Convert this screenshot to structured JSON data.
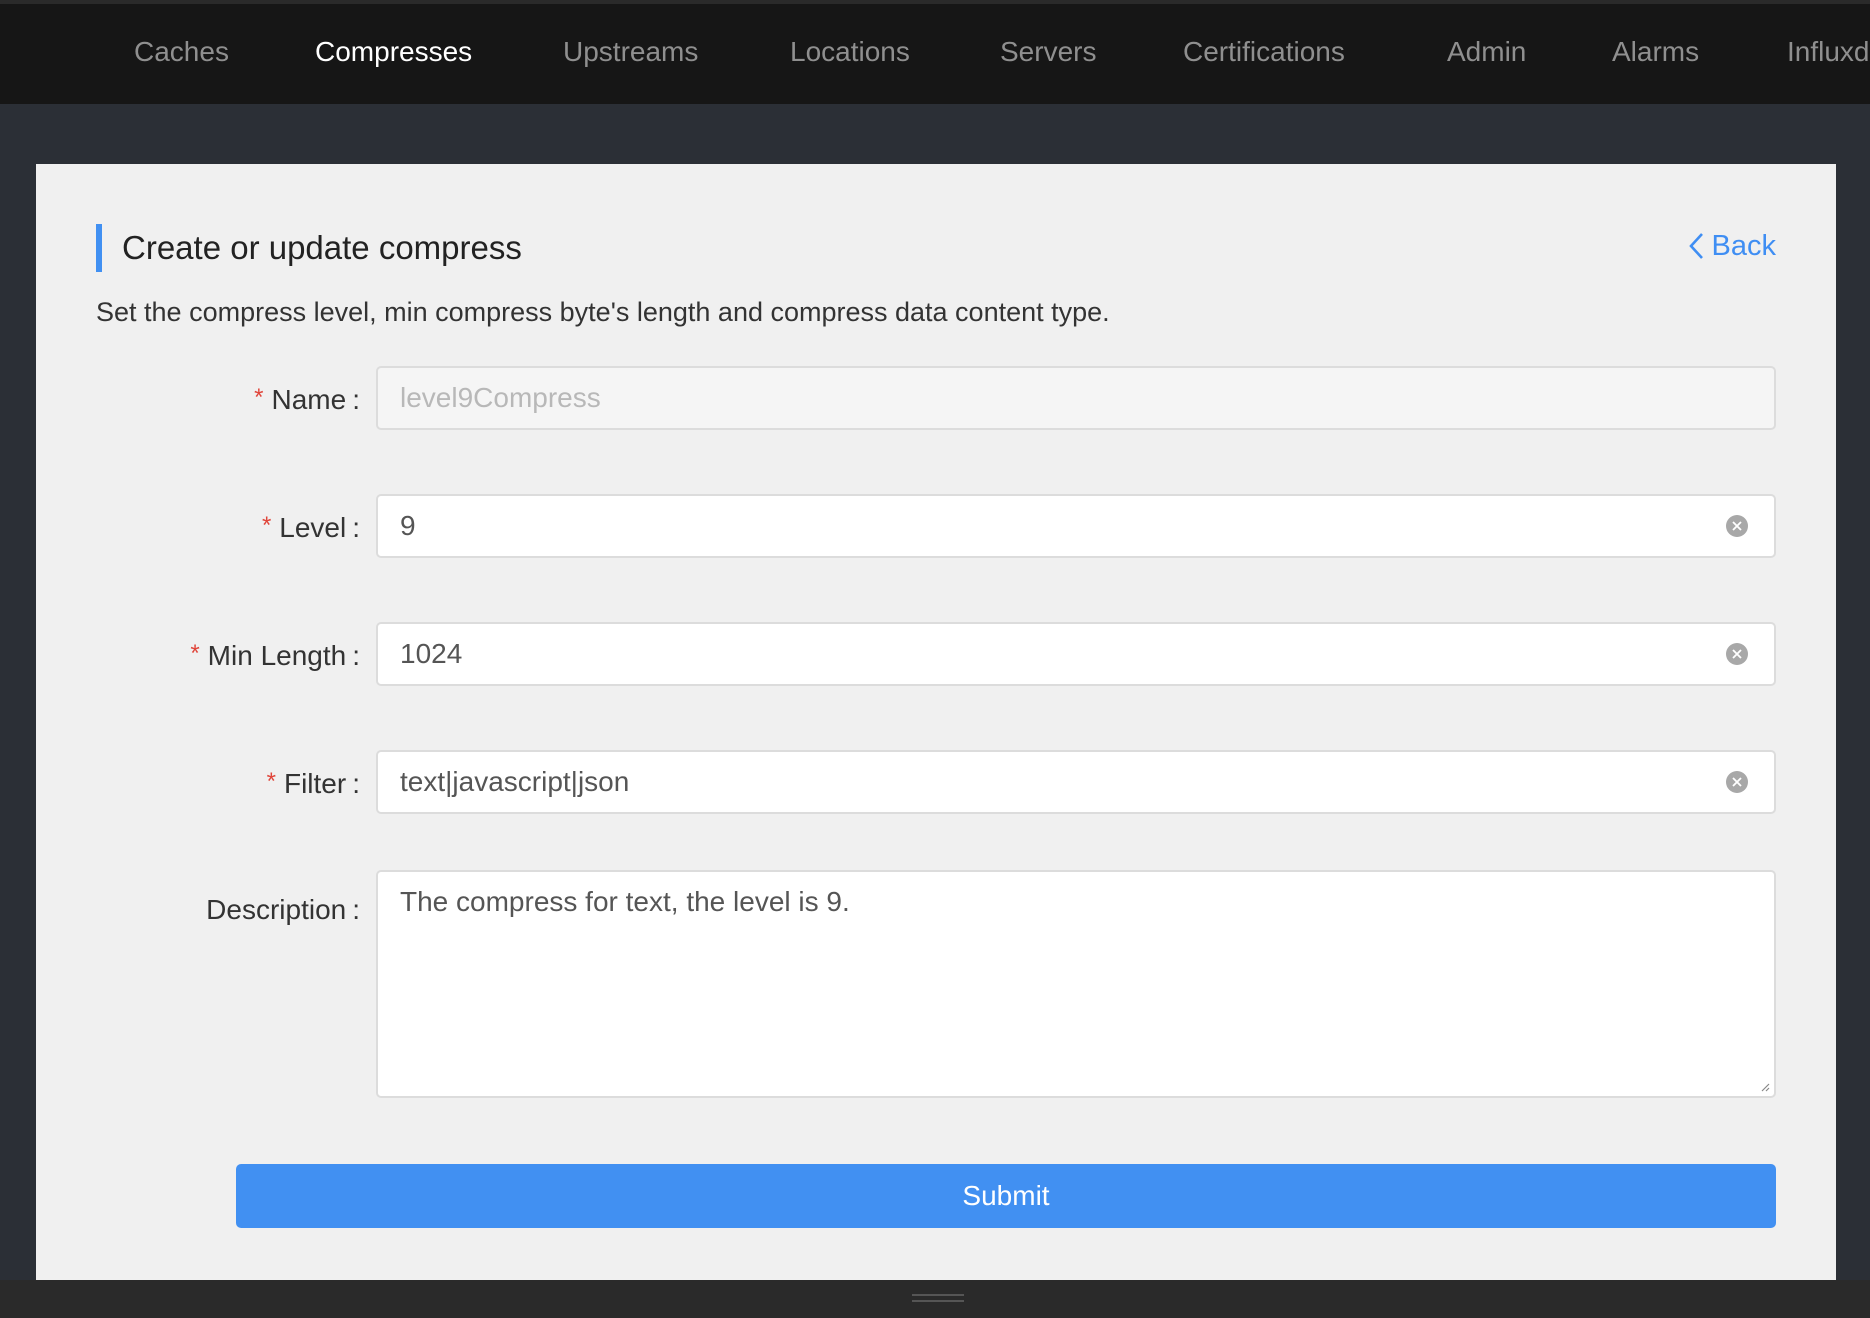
{
  "nav": {
    "items": [
      {
        "label": "Caches",
        "active": false
      },
      {
        "label": "Compresses",
        "active": true
      },
      {
        "label": "Upstreams",
        "active": false
      },
      {
        "label": "Locations",
        "active": false
      },
      {
        "label": "Servers",
        "active": false
      },
      {
        "label": "Certifications",
        "active": false
      },
      {
        "label": "Admin",
        "active": false
      },
      {
        "label": "Alarms",
        "active": false
      },
      {
        "label": "Influxd",
        "active": false
      }
    ]
  },
  "header": {
    "title": "Create or update compress",
    "back_label": "Back",
    "subtitle": "Set the compress level, min compress byte's length and compress data content type."
  },
  "form": {
    "name": {
      "label": "Name",
      "required": true,
      "value": "",
      "placeholder": "level9Compress",
      "disabled": true
    },
    "level": {
      "label": "Level",
      "required": true,
      "value": "9"
    },
    "min_length": {
      "label": "Min Length",
      "required": true,
      "value": "1024"
    },
    "filter": {
      "label": "Filter",
      "required": true,
      "value": "text|javascript|json"
    },
    "description": {
      "label": "Description",
      "required": false,
      "value": "The compress for text, the level is 9."
    },
    "required_mark": "*",
    "colon": ":",
    "submit_label": "Submit"
  },
  "colors": {
    "accent": "#4190f2",
    "required": "#e0453a",
    "topbar": "#161616",
    "background": "#2b2f36",
    "card": "#f0f0f0"
  }
}
